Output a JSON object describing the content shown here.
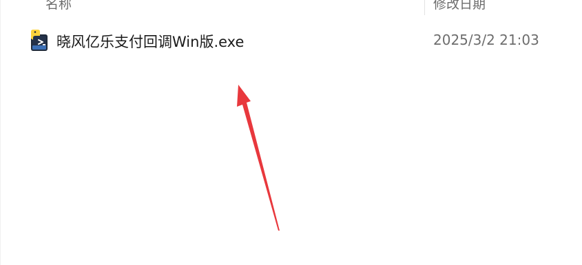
{
  "columns": {
    "name_header": "名称",
    "date_header": "修改日期"
  },
  "files": [
    {
      "name": "晓风亿乐支付回调Win版.exe",
      "modified": "2025/3/2 21:03",
      "icon": "python-exe-icon"
    }
  ],
  "annotation": {
    "arrow_color": "#e8383d"
  }
}
